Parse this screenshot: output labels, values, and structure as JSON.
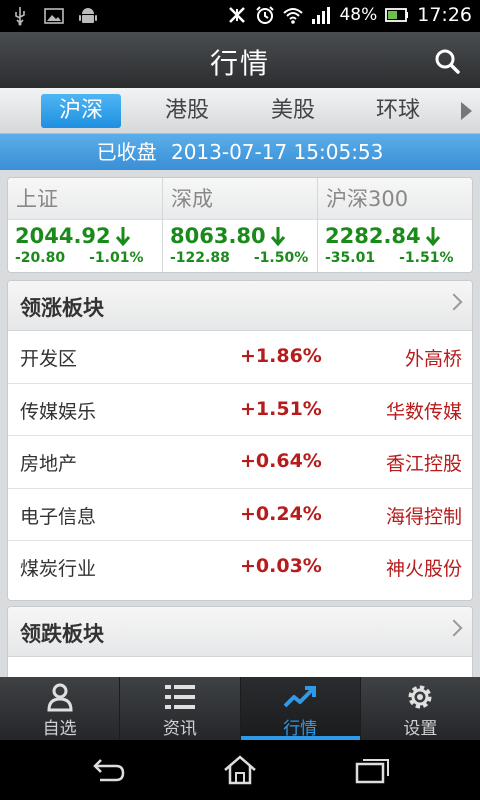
{
  "status_bar": {
    "battery": "48%",
    "time": "17:26",
    "icons": [
      "usb-icon",
      "image-icon",
      "android-icon",
      "mute-icon",
      "alarm-icon",
      "wifi-icon",
      "signal-icon",
      "battery-icon"
    ]
  },
  "header": {
    "title": "行情",
    "search_icon": "search-icon"
  },
  "tabs": [
    {
      "label": "沪深",
      "active": true
    },
    {
      "label": "港股",
      "active": false
    },
    {
      "label": "美股",
      "active": false
    },
    {
      "label": "环球",
      "active": false
    }
  ],
  "market_status": {
    "state": "已收盘",
    "datetime": "2013-07-17 15:05:53"
  },
  "indices": [
    {
      "name": "上证",
      "value": "2044.92",
      "change": "-20.80",
      "percent": "-1.01%"
    },
    {
      "name": "深成",
      "value": "8063.80",
      "change": "-122.88",
      "percent": "-1.50%"
    },
    {
      "name": "沪深300",
      "value": "2282.84",
      "change": "-35.01",
      "percent": "-1.51%"
    }
  ],
  "gainers": {
    "title": "领涨板块",
    "rows": [
      {
        "sector": "开发区",
        "percent": "+1.86%",
        "stock": "外高桥"
      },
      {
        "sector": "传媒娱乐",
        "percent": "+1.51%",
        "stock": "华数传媒"
      },
      {
        "sector": "房地产",
        "percent": "+0.64%",
        "stock": "香江控股"
      },
      {
        "sector": "电子信息",
        "percent": "+0.24%",
        "stock": "海得控制"
      },
      {
        "sector": "煤炭行业",
        "percent": "+0.03%",
        "stock": "神火股份"
      }
    ]
  },
  "losers": {
    "title": "领跌板块"
  },
  "bottom_nav": [
    {
      "label": "自选",
      "icon": "person-icon",
      "active": false
    },
    {
      "label": "资讯",
      "icon": "news-list-icon",
      "active": false
    },
    {
      "label": "行情",
      "icon": "trend-chart-icon",
      "active": true
    },
    {
      "label": "设置",
      "icon": "gear-icon",
      "active": false
    }
  ],
  "colors": {
    "accent": "#2f9ae8",
    "up": "#b71c1c",
    "down": "#1a8a1a"
  }
}
